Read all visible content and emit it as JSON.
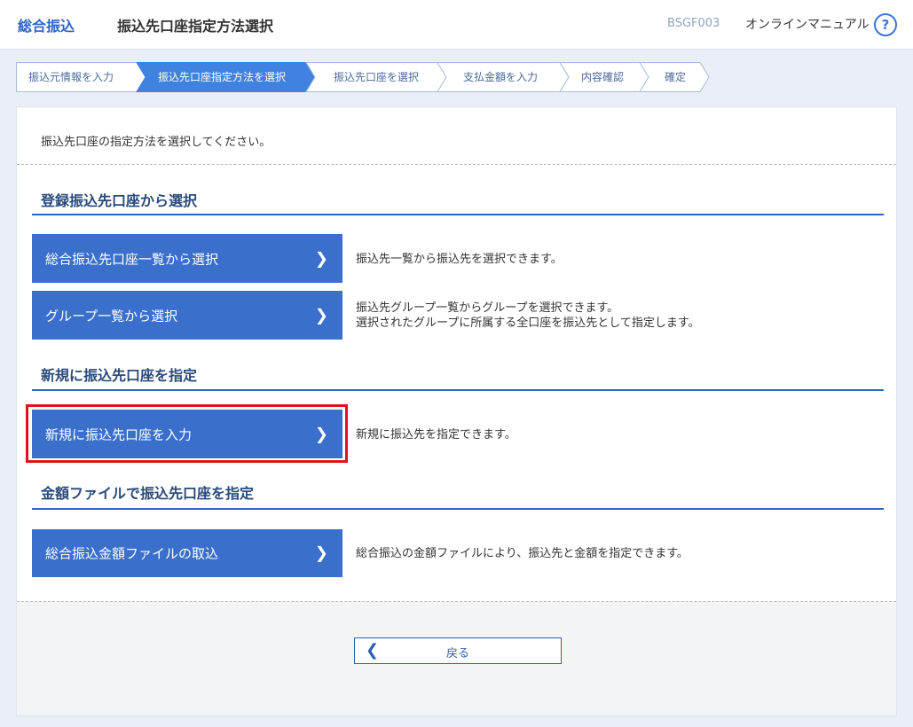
{
  "header": {
    "app_title": "総合振込",
    "page_title": "振込先口座指定方法選択",
    "screen_id": "BSGF003",
    "manual_link": "オンラインマニュアル",
    "help_icon": "?"
  },
  "steps": [
    {
      "label": "振込元情報を入力",
      "active": false
    },
    {
      "label": "振込先口座指定方法を選択",
      "active": true
    },
    {
      "label": "振込先口座を選択",
      "active": false
    },
    {
      "label": "支払金額を入力",
      "active": false
    },
    {
      "label": "内容確認",
      "active": false
    },
    {
      "label": "確定",
      "active": false
    }
  ],
  "instruction": "振込先口座の指定方法を選択してください。",
  "sections": {
    "registered": {
      "title": "登録振込先口座から選択",
      "buttons": [
        {
          "label": "総合振込先口座一覧から選択",
          "desc": "振込先一覧から振込先を選択できます。"
        },
        {
          "label": "グループ一覧から選択",
          "desc_line1": "振込先グループ一覧からグループを選択できます。",
          "desc_line2": "選択されたグループに所属する全口座を振込先として指定します。"
        }
      ]
    },
    "new": {
      "title": "新規に振込先口座を指定",
      "button": {
        "label": "新規に振込先口座を入力",
        "desc": "新規に振込先を指定できます。"
      }
    },
    "file": {
      "title": "金額ファイルで振込先口座を指定",
      "button": {
        "label": "総合振込金額ファイルの取込",
        "desc": "総合振込の金額ファイルにより、振込先と金額を指定できます。"
      }
    }
  },
  "back_button": {
    "label": "戻る"
  },
  "icons": {
    "chevron": "chevron-right-icon",
    "back": "chevron-left-icon",
    "help": "question-circle-icon"
  },
  "colors": {
    "accent": "#3a6fcb",
    "highlight": "#e0121a"
  }
}
